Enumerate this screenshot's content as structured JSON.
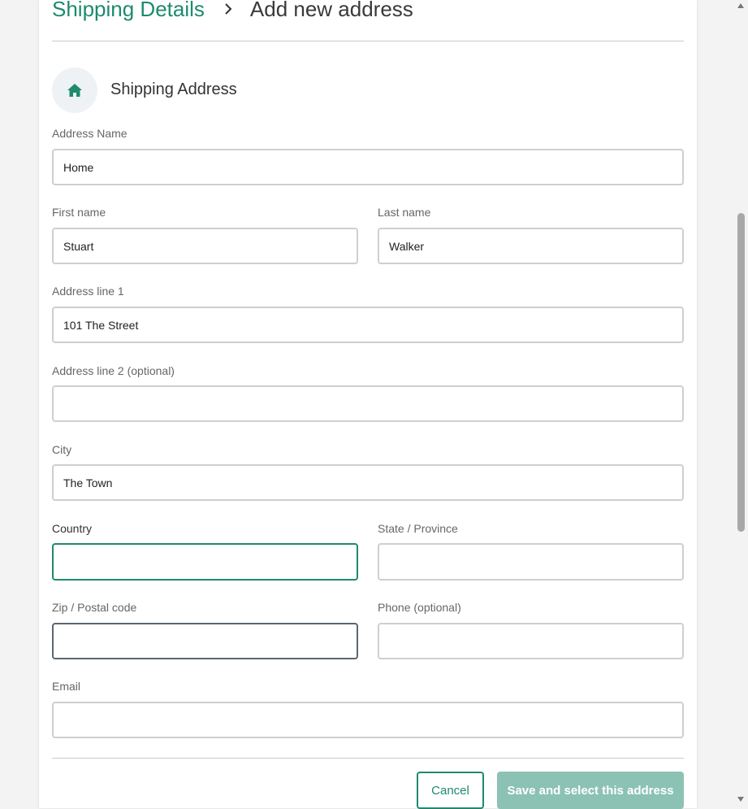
{
  "breadcrumb": {
    "parent": "Shipping Details",
    "current": "Add new address"
  },
  "section": {
    "title": "Shipping Address",
    "icon": "home-icon"
  },
  "fields": {
    "address_name": {
      "label": "Address Name",
      "value": "Home"
    },
    "first_name": {
      "label": "First name",
      "value": "Stuart"
    },
    "last_name": {
      "label": "Last name",
      "value": "Walker"
    },
    "address_line1": {
      "label": "Address line 1",
      "value": "101 The Street"
    },
    "address_line2": {
      "label": "Address line 2 (optional)",
      "value": ""
    },
    "city": {
      "label": "City",
      "value": "The Town"
    },
    "country": {
      "label": "Country",
      "value": ""
    },
    "state": {
      "label": "State / Province",
      "value": ""
    },
    "zip": {
      "label": "Zip / Postal code",
      "value": ""
    },
    "phone": {
      "label": "Phone (optional)",
      "value": ""
    },
    "email": {
      "label": "Email",
      "value": ""
    }
  },
  "buttons": {
    "cancel": "Cancel",
    "save": "Save and select this address"
  },
  "colors": {
    "accent": "#1e8a6e",
    "save_disabled": "#8cc2b3"
  }
}
